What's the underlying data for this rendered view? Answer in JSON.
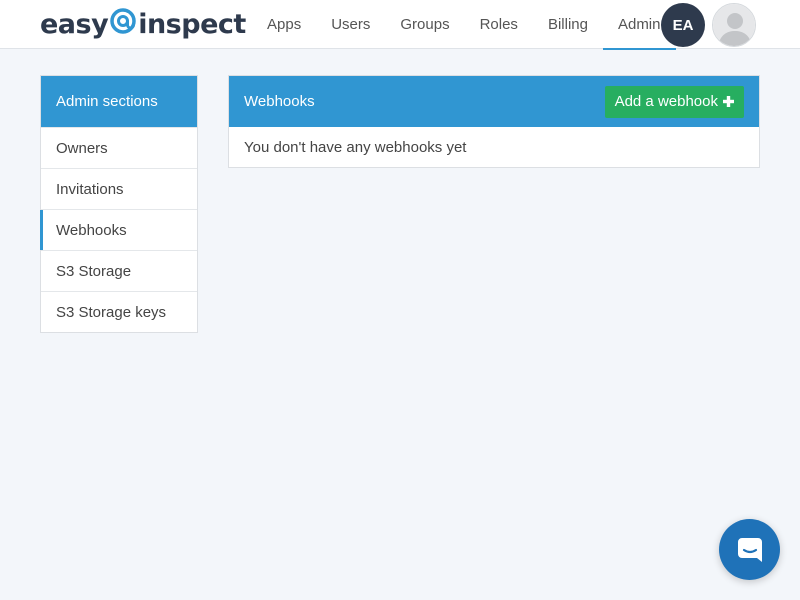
{
  "logo": {
    "part1": "easy",
    "part2": "inspect"
  },
  "nav": {
    "items": [
      {
        "label": "Apps"
      },
      {
        "label": "Users"
      },
      {
        "label": "Groups"
      },
      {
        "label": "Roles"
      },
      {
        "label": "Billing"
      },
      {
        "label": "Admin",
        "active": true
      }
    ]
  },
  "user": {
    "initials": "EA"
  },
  "sidebar": {
    "title": "Admin sections",
    "items": [
      {
        "label": "Owners"
      },
      {
        "label": "Invitations"
      },
      {
        "label": "Webhooks",
        "active": true
      },
      {
        "label": "S3 Storage"
      },
      {
        "label": "S3 Storage keys"
      }
    ]
  },
  "panel": {
    "title": "Webhooks",
    "add_button_label": "Add a webhook",
    "empty_message": "You don't have any webhooks yet"
  },
  "icons": {
    "add": "plus-icon",
    "chat": "chat-icon",
    "profile": "user-silhouette-icon"
  },
  "colors": {
    "accent": "#3096d2",
    "success": "#27ae60",
    "dark": "#2e3a4d",
    "chat": "#1f72b8"
  }
}
